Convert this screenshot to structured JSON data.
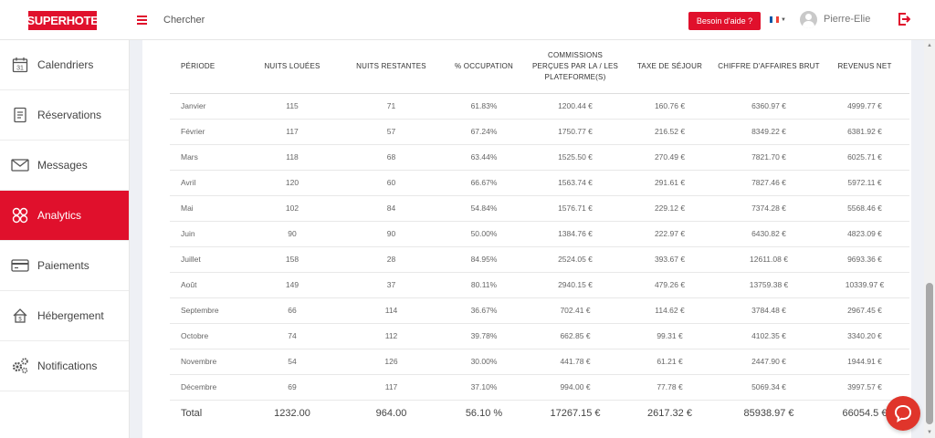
{
  "header": {
    "logo_text": "SUPERHOTE",
    "search_label": "Chercher",
    "help_label": "Besoin d'aide ?",
    "user_name": "Pierre-Elie",
    "language": "FR"
  },
  "sidebar": {
    "items": [
      {
        "label": "Calendriers",
        "icon": "calendar-icon"
      },
      {
        "label": "Réservations",
        "icon": "reservations-icon"
      },
      {
        "label": "Messages",
        "icon": "envelope-icon"
      },
      {
        "label": "Analytics",
        "icon": "analytics-icon",
        "active": true
      },
      {
        "label": "Paiements",
        "icon": "credit-card-icon"
      },
      {
        "label": "Hébergement",
        "icon": "house-icon"
      },
      {
        "label": "Notifications",
        "icon": "gears-icon"
      }
    ]
  },
  "table": {
    "headers": [
      "PÉRIODE",
      "NUITS LOUÉES",
      "NUITS RESTANTES",
      "% OCCUPATION",
      "COMMISSIONS PERÇUES PAR LA / LES PLATEFORME(S)",
      "TAXE DE SÉJOUR",
      "CHIFFRE D'AFFAIRES BRUT",
      "REVENUS NET"
    ],
    "rows": [
      [
        "Janvier",
        "115",
        "71",
        "61.83%",
        "1200.44 €",
        "160.76 €",
        "6360.97 €",
        "4999.77 €"
      ],
      [
        "Février",
        "117",
        "57",
        "67.24%",
        "1750.77 €",
        "216.52 €",
        "8349.22 €",
        "6381.92 €"
      ],
      [
        "Mars",
        "118",
        "68",
        "63.44%",
        "1525.50 €",
        "270.49 €",
        "7821.70 €",
        "6025.71 €"
      ],
      [
        "Avril",
        "120",
        "60",
        "66.67%",
        "1563.74 €",
        "291.61 €",
        "7827.46 €",
        "5972.11 €"
      ],
      [
        "Mai",
        "102",
        "84",
        "54.84%",
        "1576.71 €",
        "229.12 €",
        "7374.28 €",
        "5568.46 €"
      ],
      [
        "Juin",
        "90",
        "90",
        "50.00%",
        "1384.76 €",
        "222.97 €",
        "6430.82 €",
        "4823.09 €"
      ],
      [
        "Juillet",
        "158",
        "28",
        "84.95%",
        "2524.05 €",
        "393.67 €",
        "12611.08 €",
        "9693.36 €"
      ],
      [
        "Août",
        "149",
        "37",
        "80.11%",
        "2940.15 €",
        "479.26 €",
        "13759.38 €",
        "10339.97 €"
      ],
      [
        "Septembre",
        "66",
        "114",
        "36.67%",
        "702.41 €",
        "114.62 €",
        "3784.48 €",
        "2967.45 €"
      ],
      [
        "Octobre",
        "74",
        "112",
        "39.78%",
        "662.85 €",
        "99.31 €",
        "4102.35 €",
        "3340.20 €"
      ],
      [
        "Novembre",
        "54",
        "126",
        "30.00%",
        "441.78 €",
        "61.21 €",
        "2447.90 €",
        "1944.91 €"
      ],
      [
        "Décembre",
        "69",
        "117",
        "37.10%",
        "994.00 €",
        "77.78 €",
        "5069.34 €",
        "3997.57 €"
      ]
    ],
    "total": [
      "Total",
      "1232.00",
      "964.00",
      "56.10 %",
      "17267.15 €",
      "2617.32 €",
      "85938.97 €",
      "66054.5 €"
    ]
  },
  "colors": {
    "accent": "#e0102c",
    "chat": "#e0352b",
    "background": "#eef0f5"
  }
}
